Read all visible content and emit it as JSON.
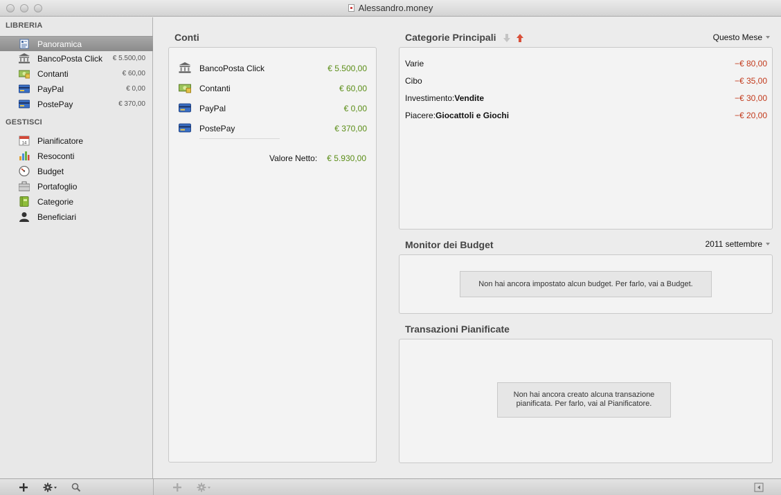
{
  "window": {
    "title": "Alessandro.money"
  },
  "sidebar": {
    "library_heading": "LIBRERIA",
    "manage_heading": "GESTISCI",
    "library_items": [
      {
        "label": "Panoramica",
        "amount": ""
      },
      {
        "label": "BancoPosta Click",
        "amount": "€ 5.500,00"
      },
      {
        "label": "Contanti",
        "amount": "€ 60,00"
      },
      {
        "label": "PayPal",
        "amount": "€ 0,00"
      },
      {
        "label": "PostePay",
        "amount": "€ 370,00"
      }
    ],
    "manage_items": [
      {
        "label": "Pianificatore"
      },
      {
        "label": "Resoconti"
      },
      {
        "label": "Budget"
      },
      {
        "label": "Portafoglio"
      },
      {
        "label": "Categorie"
      },
      {
        "label": "Beneficiari"
      }
    ]
  },
  "accounts": {
    "title": "Conti",
    "rows": [
      {
        "label": "BancoPosta Click",
        "amount": "€ 5.500,00"
      },
      {
        "label": "Contanti",
        "amount": "€ 60,00"
      },
      {
        "label": "PayPal",
        "amount": "€ 0,00"
      },
      {
        "label": "PostePay",
        "amount": "€ 370,00"
      }
    ],
    "net_label": "Valore Netto:",
    "net_value": "€ 5.930,00"
  },
  "categories": {
    "title": "Categorie Principali",
    "period": "Questo Mese",
    "rows": [
      {
        "prefix": "Varie",
        "bold": "",
        "amount": "−€ 80,00"
      },
      {
        "prefix": "Cibo",
        "bold": "",
        "amount": "−€ 35,00"
      },
      {
        "prefix": "Investimento:",
        "bold": "Vendite",
        "amount": "−€ 30,00"
      },
      {
        "prefix": "Piacere:",
        "bold": "Giocattoli e Giochi",
        "amount": "−€ 20,00"
      }
    ]
  },
  "budget": {
    "title": "Monitor dei Budget",
    "period": "2011 settembre",
    "empty_message": "Non hai ancora impostato alcun budget. Per farlo, vai a Budget."
  },
  "scheduled": {
    "title": "Transazioni Pianificate",
    "empty_message_line1": "Non hai ancora creato alcuna transazione",
    "empty_message_line2": "pianificata. Per farlo, vai al Pianificatore."
  },
  "colors": {
    "positive": "#5a8d16",
    "negative": "#c23a1c",
    "selection": "#999999"
  }
}
